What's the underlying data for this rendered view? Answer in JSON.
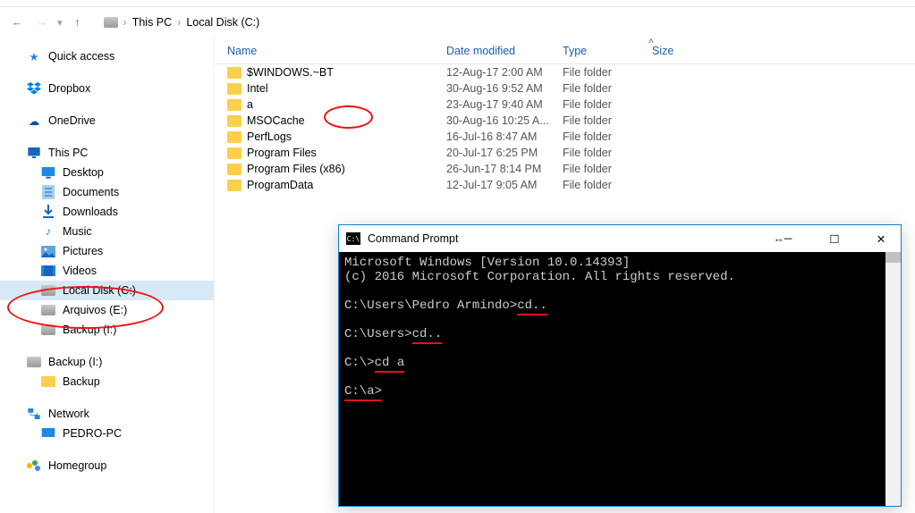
{
  "breadcrumb": {
    "root": "This PC",
    "path1": "Local Disk (C:)"
  },
  "sidebar": {
    "quick": "Quick access",
    "dropbox": "Dropbox",
    "onedrive": "OneDrive",
    "thispc": "This PC",
    "desktop": "Desktop",
    "documents": "Documents",
    "downloads": "Downloads",
    "music": "Music",
    "pictures": "Pictures",
    "videos": "Videos",
    "localc": "Local Disk (C:)",
    "arquivos": "Arquivos (E:)",
    "backupI1": "Backup (I:)",
    "backupI2": "Backup (I:)",
    "backupFolder": "Backup",
    "network": "Network",
    "pedropc": "PEDRO-PC",
    "homegroup": "Homegroup"
  },
  "columns": {
    "name": "Name",
    "date": "Date modified",
    "type": "Type",
    "size": "Size"
  },
  "files": [
    {
      "name": "$WINDOWS.~BT",
      "date": "12-Aug-17 2:00 AM",
      "type": "File folder"
    },
    {
      "name": "Intel",
      "date": "30-Aug-16 9:52 AM",
      "type": "File folder"
    },
    {
      "name": "a",
      "date": "23-Aug-17 9:40 AM",
      "type": "File folder"
    },
    {
      "name": "MSOCache",
      "date": "30-Aug-16 10:25 A...",
      "type": "File folder"
    },
    {
      "name": "PerfLogs",
      "date": "16-Jul-16 8:47 AM",
      "type": "File folder"
    },
    {
      "name": "Program Files",
      "date": "20-Jul-17 6:25 PM",
      "type": "File folder"
    },
    {
      "name": "Program Files (x86)",
      "date": "26-Jun-17 8:14 PM",
      "type": "File folder"
    },
    {
      "name": "ProgramData",
      "date": "12-Jul-17 9:05 AM",
      "type": "File folder"
    }
  ],
  "cmd": {
    "title": "Command Prompt",
    "line1": "Microsoft Windows [Version 10.0.14393]",
    "line2": "(c) 2016 Microsoft Corporation. All rights reserved.",
    "p1a": "C:\\Users\\Pedro Armindo>",
    "p1b": "cd..",
    "p2a": "C:\\Users>",
    "p2b": "cd..",
    "p3a": "C:\\>",
    "p3b": "cd a",
    "p4a": "C:\\a>"
  }
}
